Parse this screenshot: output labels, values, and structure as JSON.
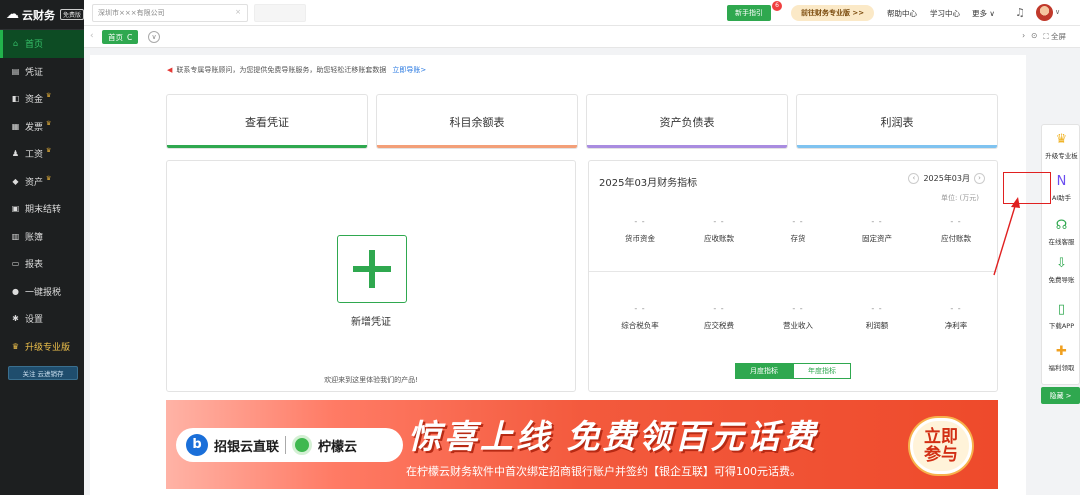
{
  "app": {
    "brand": "云财务",
    "edition_badge": "免费版"
  },
  "sidebar": {
    "items": [
      {
        "label": "首页",
        "icon": "home-icon",
        "glyph": "⌂",
        "active": true,
        "crown": false
      },
      {
        "label": "凭证",
        "icon": "voucher-icon",
        "glyph": "▤",
        "active": false,
        "crown": false
      },
      {
        "label": "资金",
        "icon": "fund-icon",
        "glyph": "◧",
        "active": false,
        "crown": true
      },
      {
        "label": "发票",
        "icon": "invoice-icon",
        "glyph": "▦",
        "active": false,
        "crown": true
      },
      {
        "label": "工资",
        "icon": "salary-icon",
        "glyph": "♟",
        "active": false,
        "crown": true
      },
      {
        "label": "资产",
        "icon": "asset-icon",
        "glyph": "◆",
        "active": false,
        "crown": true
      },
      {
        "label": "期末结转",
        "icon": "period-close-icon",
        "glyph": "▣",
        "active": false,
        "crown": false
      },
      {
        "label": "账簿",
        "icon": "ledger-icon",
        "glyph": "▥",
        "active": false,
        "crown": false
      },
      {
        "label": "报表",
        "icon": "report-icon",
        "glyph": "▭",
        "active": false,
        "crown": false
      },
      {
        "label": "一键报税",
        "icon": "tax-icon",
        "glyph": "●",
        "active": false,
        "crown": false
      },
      {
        "label": "设置",
        "icon": "settings-icon",
        "glyph": "✱",
        "active": false,
        "crown": false
      },
      {
        "label": "升级专业版",
        "icon": "upgrade-crown-icon",
        "glyph": "♛",
        "active": false,
        "crown": false,
        "pro": true
      }
    ],
    "follow_button": "关注 云进销存"
  },
  "topbar": {
    "company_tab": "深圳市×××有限公司",
    "guide_label": "新手指引",
    "guide_count": "6",
    "pro_label": "前往财务专业版 >>",
    "help": "帮助中心",
    "study": "学习中心",
    "more": "更多 ∨"
  },
  "subbar": {
    "home_tab": "首页",
    "refresh": "C",
    "fullscreen": "全屏"
  },
  "notice": {
    "text": "联系专属导账顾问，为您提供免费导账服务，助您轻松迁移账套数据",
    "link": "立即导账>"
  },
  "quick_cards": [
    {
      "label": "查看凭证",
      "color": "#2fa84f"
    },
    {
      "label": "科目余额表",
      "color": "#f39f78"
    },
    {
      "label": "资产负债表",
      "color": "#a98ce0"
    },
    {
      "label": "利润表",
      "color": "#7fc3f0"
    }
  ],
  "new_voucher": {
    "label": "新增凭证",
    "welcome": "欢迎来到这里体验我们的产品!"
  },
  "indicators": {
    "title": "2025年03月财务指标",
    "month": "2025年03月",
    "unit": "单位: (万元)",
    "row1": [
      {
        "val": "- -",
        "label": "货币资金"
      },
      {
        "val": "- -",
        "label": "应收账款"
      },
      {
        "val": "- -",
        "label": "存货"
      },
      {
        "val": "- -",
        "label": "固定资产"
      },
      {
        "val": "- -",
        "label": "应付账款"
      }
    ],
    "row2": [
      {
        "val": "- -",
        "label": "综合税负率"
      },
      {
        "val": "- -",
        "label": "应交税费"
      },
      {
        "val": "- -",
        "label": "营业收入"
      },
      {
        "val": "- -",
        "label": "利润额"
      },
      {
        "val": "- -",
        "label": "净利率"
      }
    ],
    "toggle_on": "月度指标",
    "toggle_off": "年度指标"
  },
  "banner": {
    "logo_text1": "招银云直联",
    "logo_text2": "柠檬云",
    "headline": "惊喜上线 免费领百元话费",
    "subline": "在柠檬云财务软件中首次绑定招商银行账户并签约【银企互联】可得100元话费。",
    "cta_line1": "立即",
    "cta_line2": "参与"
  },
  "float_panel": {
    "items": [
      {
        "label": "升级专业板",
        "icon": "crown-icon",
        "glyph": "♛",
        "color": "#f0b429"
      },
      {
        "label": "AI助手",
        "icon": "ai-assistant-icon",
        "glyph": "N",
        "color": "#6b4df0"
      },
      {
        "label": "在线客服",
        "icon": "headset-icon",
        "glyph": "☊",
        "color": "#2fa84f"
      },
      {
        "label": "免费导账",
        "icon": "download-icon",
        "glyph": "⇩",
        "color": "#2fa84f"
      },
      {
        "label": "下载APP",
        "icon": "mobile-icon",
        "glyph": "▯",
        "color": "#2fa84f"
      },
      {
        "label": "福利领取",
        "icon": "gift-icon",
        "glyph": "✚",
        "color": "#f0a020"
      }
    ],
    "hide_button": "隐藏 >"
  }
}
